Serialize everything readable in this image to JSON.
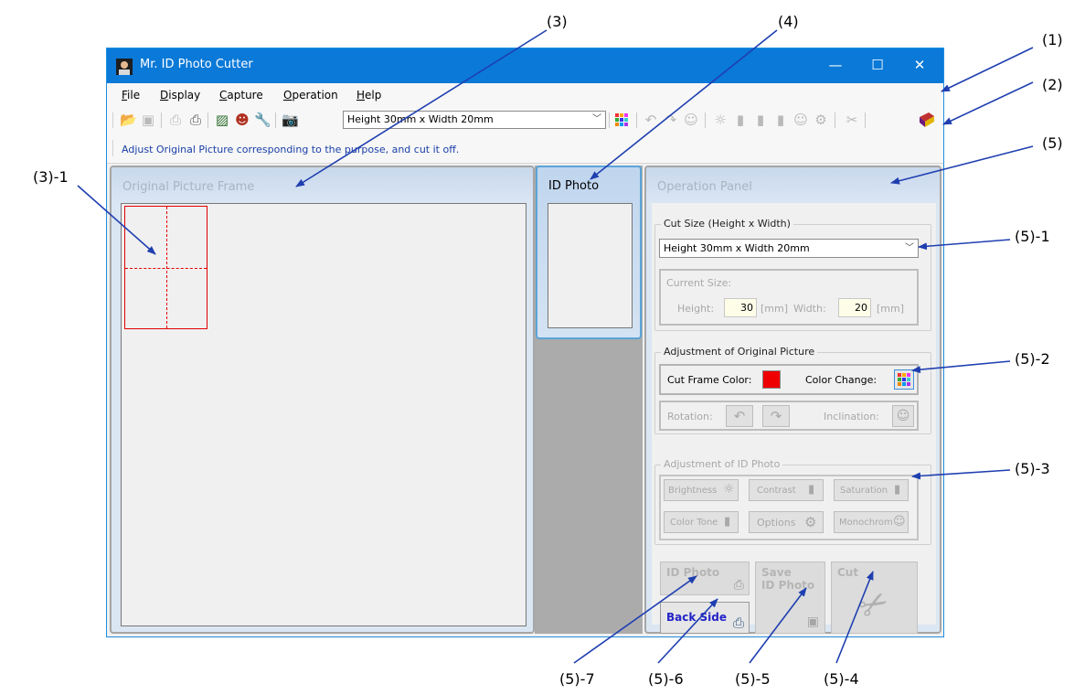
{
  "window": {
    "title": "Mr. ID Photo Cutter",
    "minimize": "—",
    "maximize": "☐",
    "close": "✕"
  },
  "menu": [
    "File",
    "Display",
    "Capture",
    "Operation",
    "Help"
  ],
  "menu_accel": [
    "F",
    "D",
    "C",
    "O",
    "H"
  ],
  "toolbar": {
    "size_combo_value": "Height 30mm x Width 20mm"
  },
  "status_text": "Adjust Original Picture corresponding to the purpose, and cut it off.",
  "original_frame": {
    "title": "Original Picture Frame"
  },
  "id_photo_tab": {
    "title": "ID Photo"
  },
  "operation_panel": {
    "title": "Operation Panel",
    "cut_size": {
      "caption": "Cut Size (Height x Width)",
      "combo_value": "Height 30mm x Width 20mm",
      "current_size_label": "Current Size:",
      "height_label": "Height:",
      "height_value": "30",
      "unit1": "[mm]",
      "width_label": "Width:",
      "width_value": "20",
      "unit2": "[mm]"
    },
    "adjust_original": {
      "caption": "Adjustment of Original Picture",
      "cut_frame_color_label": "Cut Frame Color:",
      "cut_frame_color": "#ee0000",
      "color_change_label": "Color Change:",
      "rotation_label": "Rotation:",
      "inclination_label": "Inclination:"
    },
    "adjust_id": {
      "caption": "Adjustment of ID Photo",
      "brightness": "Brightness",
      "contrast": "Contrast",
      "saturation": "Saturation",
      "color_tone": "Color Tone",
      "options": "Options",
      "monochrome": "Monochrom"
    },
    "buttons": {
      "id_photo": "ID Photo",
      "back_side": "Back Side",
      "save_id_photo_1": "Save",
      "save_id_photo_2": "ID Photo",
      "cut": "Cut"
    }
  },
  "annotations": {
    "a1": "(1)",
    "a2": "(2)",
    "a3": "(3)",
    "a4": "(4)",
    "a5": "(5)",
    "a3_1": "(3)-1",
    "a5_1": "(5)-1",
    "a5_2": "(5)-2",
    "a5_3": "(5)-3",
    "a5_4": "(5)-4",
    "a5_5": "(5)-5",
    "a5_6": "(5)-6",
    "a5_7": "(5)-7"
  },
  "colors": {
    "titlebar": "#0a79d8",
    "annotation_arrow": "#1f3fb0",
    "status_text": "#1a3fa8",
    "cut_frame": "#ee0000"
  }
}
